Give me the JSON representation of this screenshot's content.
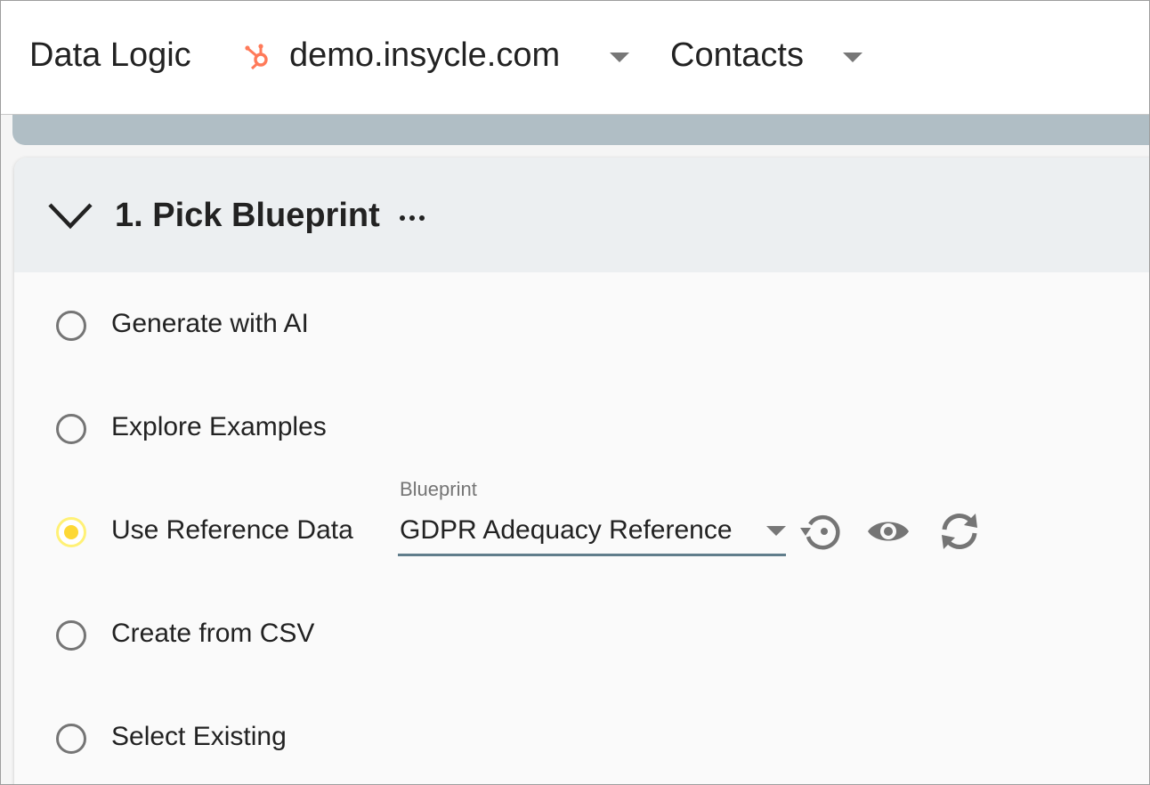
{
  "header": {
    "app_title": "Data Logic",
    "portal": "demo.insycle.com",
    "object": "Contacts",
    "brand_color": "#ff7a59"
  },
  "card": {
    "title": "1. Pick Blueprint",
    "options": [
      {
        "label": "Generate with AI",
        "selected": false
      },
      {
        "label": "Explore Examples",
        "selected": false
      },
      {
        "label": "Use Reference Data",
        "selected": true
      },
      {
        "label": "Create from CSV",
        "selected": false
      },
      {
        "label": "Select Existing",
        "selected": false
      }
    ],
    "blueprint": {
      "label": "Blueprint",
      "value": "GDPR Adequacy Reference"
    },
    "icons": [
      "chevron-down-icon",
      "more-icon",
      "reset-icon",
      "eye-icon",
      "sync-icon",
      "hubspot-icon"
    ],
    "colors": {
      "header_bg": "#eceff1",
      "strip_bg": "#b0bec5",
      "radio_selected": "#fdd835",
      "underline": "#607d8b"
    }
  }
}
